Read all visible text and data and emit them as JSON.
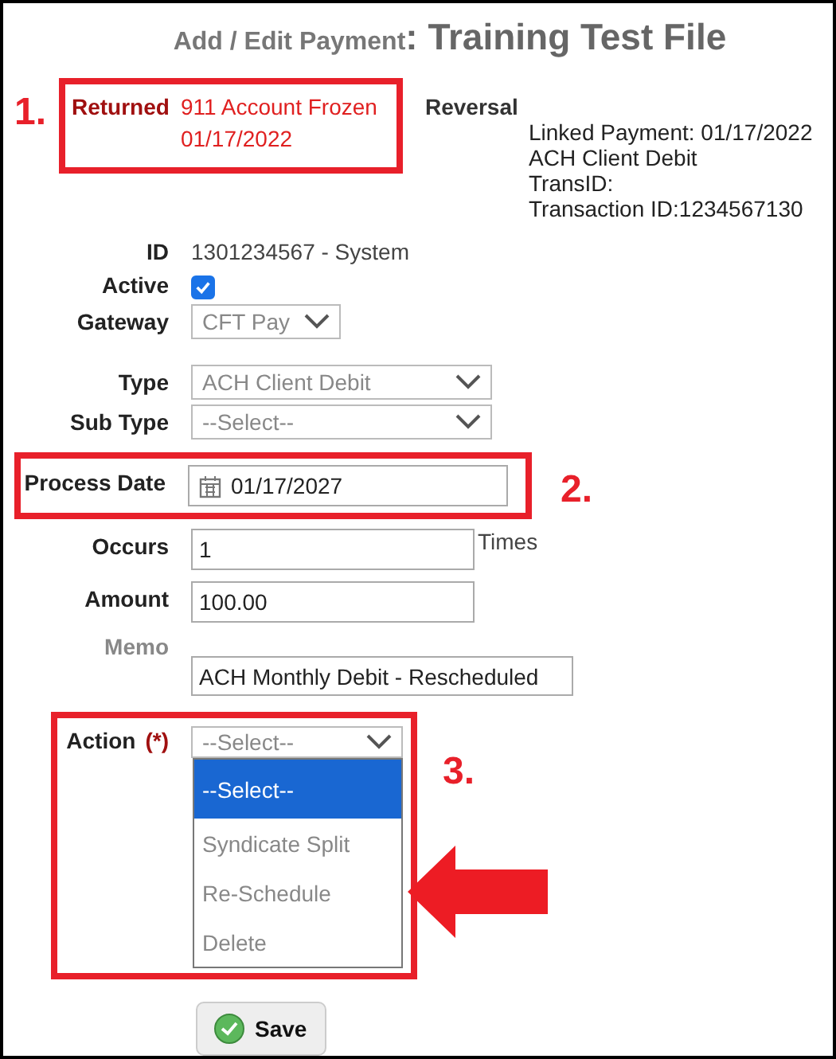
{
  "title": {
    "prefix": "Add / Edit Payment",
    "name": ": Training Test File"
  },
  "returned": {
    "label": "Returned",
    "reason": "911 Account Frozen",
    "date": "01/17/2022",
    "callout": "1."
  },
  "reversal": {
    "label": "Reversal",
    "lines": [
      "Linked Payment: 01/17/2022",
      "ACH Client Debit",
      "TransID:",
      "Transaction ID:1234567130"
    ]
  },
  "fields": [
    {
      "kind": "text",
      "label": "ID",
      "value": "1301234567 - System"
    },
    {
      "kind": "checkbox",
      "label": "Active",
      "checked": true
    },
    {
      "kind": "select",
      "label": "Gateway",
      "value": "CFT Pay"
    },
    {
      "kind": "select",
      "label": "Type",
      "value": "ACH Client Debit"
    },
    {
      "kind": "select",
      "label": "Sub Type",
      "value": "--Select--"
    },
    {
      "kind": "date",
      "label": "Process Date",
      "value": "01/17/2027",
      "callout": "2."
    },
    {
      "kind": "input",
      "label": "Occurs",
      "value": "1",
      "suffix": "Times"
    },
    {
      "kind": "input",
      "label": "Amount",
      "value": "100.00"
    },
    {
      "kind": "memo",
      "label": "Memo",
      "value": "ACH Monthly Debit - Rescheduled"
    }
  ],
  "action": {
    "label": "Action",
    "required": "(*)",
    "value": "--Select--",
    "callout": "3.",
    "expanded": true,
    "options": [
      {
        "label": "--Select--",
        "selected": true
      },
      {
        "label": "Syndicate Split",
        "selected": false
      },
      {
        "label": "Re-Schedule",
        "selected": false,
        "pointed": true
      },
      {
        "label": "Delete",
        "selected": false
      }
    ]
  },
  "save": {
    "label": "Save"
  }
}
